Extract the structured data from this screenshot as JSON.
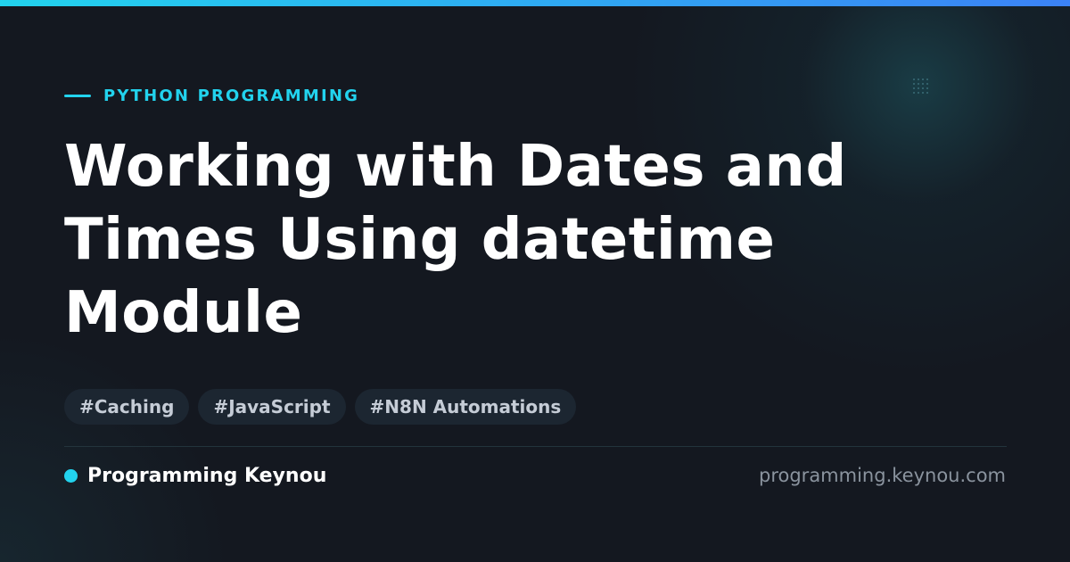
{
  "category": "PYTHON PROGRAMMING",
  "title": "Working with Dates and Times Using datetime Module",
  "tags": [
    "#Caching",
    "#JavaScript",
    "#N8N Automations"
  ],
  "brand": "Programming Keynou",
  "site": "programming.keynou.com",
  "colors": {
    "accent": "#22d3ee",
    "accent_end": "#3b82f6",
    "background": "#141820",
    "tag_background": "#1c2631"
  },
  "icons": {
    "eyebrow": "accent-line-icon",
    "brand": "brand-dot-icon",
    "decoration": "dot-grid-icon"
  }
}
